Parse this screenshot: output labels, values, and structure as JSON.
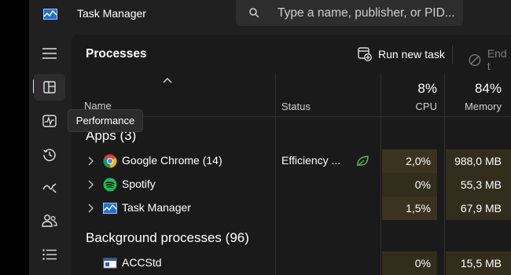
{
  "app": {
    "title": "Task Manager"
  },
  "search": {
    "placeholder": "Type a name, publisher, or PID..."
  },
  "nav": {
    "items": [
      {
        "name": "menu",
        "icon": "hamburger-icon",
        "active": false
      },
      {
        "name": "processes",
        "icon": "processes-icon",
        "active": true
      },
      {
        "name": "performance",
        "icon": "performance-icon",
        "active": false
      },
      {
        "name": "app-history",
        "icon": "history-icon",
        "active": false
      },
      {
        "name": "startup-apps",
        "icon": "startup-icon",
        "active": false
      },
      {
        "name": "users",
        "icon": "users-icon",
        "active": false
      },
      {
        "name": "details",
        "icon": "details-list-icon",
        "active": false
      }
    ]
  },
  "tooltip": {
    "text": "Performance"
  },
  "header": {
    "title": "Processes",
    "run_task_label": "Run new task",
    "end_task_label": "End t"
  },
  "columns": {
    "name": "Name",
    "status": "Status",
    "cpu_pct": "8%",
    "cpu": "CPU",
    "memory_pct": "84%",
    "memory": "Memory"
  },
  "sections": {
    "apps": "Apps (3)",
    "background": "Background processes (96)"
  },
  "rows": [
    {
      "name": "Google Chrome (14)",
      "status": "Efficiency ...",
      "cpu": "2,0%",
      "memory": "988,0 MB",
      "icon": "chrome-icon"
    },
    {
      "name": "Spotify",
      "status": "",
      "cpu": "0%",
      "memory": "55,3 MB",
      "icon": "spotify-icon"
    },
    {
      "name": "Task Manager",
      "status": "",
      "cpu": "1,5%",
      "memory": "67,9 MB",
      "icon": "task-manager-icon"
    },
    {
      "name": "ACCStd",
      "status": "",
      "cpu": "0%",
      "memory": "15,5 MB",
      "icon": "app-window-icon"
    }
  ],
  "colors": {
    "accent": "#cfe4f7",
    "efficiency_leaf": "#5fb35f",
    "cell_tint": "#3a3320"
  }
}
